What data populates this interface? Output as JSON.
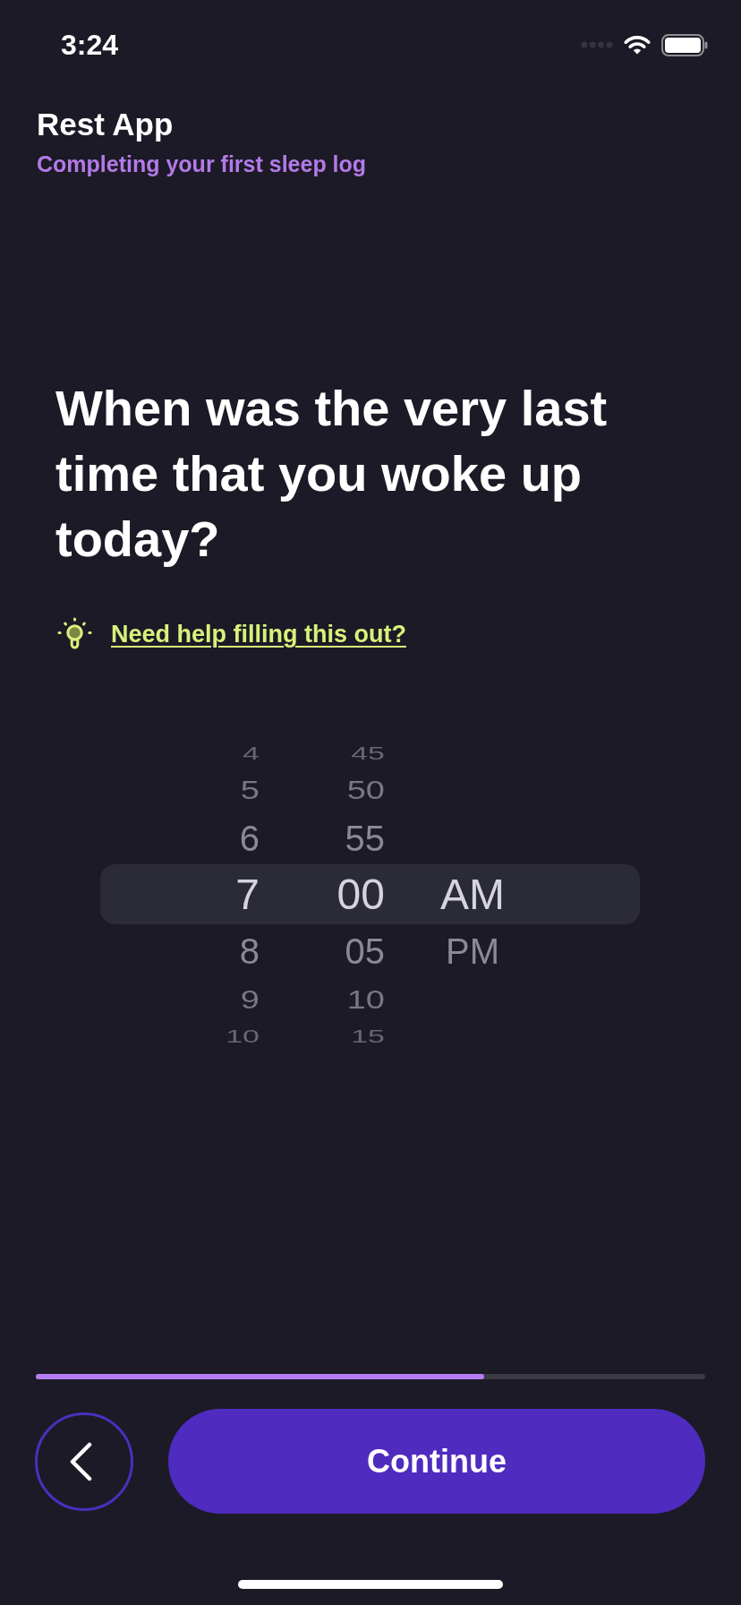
{
  "status_bar": {
    "time": "3:24"
  },
  "header": {
    "title": "Rest App",
    "subtitle": "Completing your first sleep log"
  },
  "question": "When was the very last time that you woke up today?",
  "help_link": "Need help filling this out?",
  "picker": {
    "columns": [
      {
        "kind": "hour",
        "items": [
          {
            "label": "4",
            "selected": false
          },
          {
            "label": "5",
            "selected": false
          },
          {
            "label": "6",
            "selected": false
          },
          {
            "label": "7",
            "selected": true
          },
          {
            "label": "8",
            "selected": false
          },
          {
            "label": "9",
            "selected": false
          },
          {
            "label": "10",
            "selected": false
          }
        ]
      },
      {
        "kind": "minute",
        "items": [
          {
            "label": "45",
            "selected": false
          },
          {
            "label": "50",
            "selected": false
          },
          {
            "label": "55",
            "selected": false
          },
          {
            "label": "00",
            "selected": true
          },
          {
            "label": "05",
            "selected": false
          },
          {
            "label": "10",
            "selected": false
          },
          {
            "label": "15",
            "selected": false
          }
        ]
      },
      {
        "kind": "period",
        "items": [
          {
            "label": "AM",
            "selected": true
          },
          {
            "label": "PM",
            "selected": false
          }
        ]
      }
    ]
  },
  "progress": {
    "level": 0.67
  },
  "continue_button": "Continue"
}
